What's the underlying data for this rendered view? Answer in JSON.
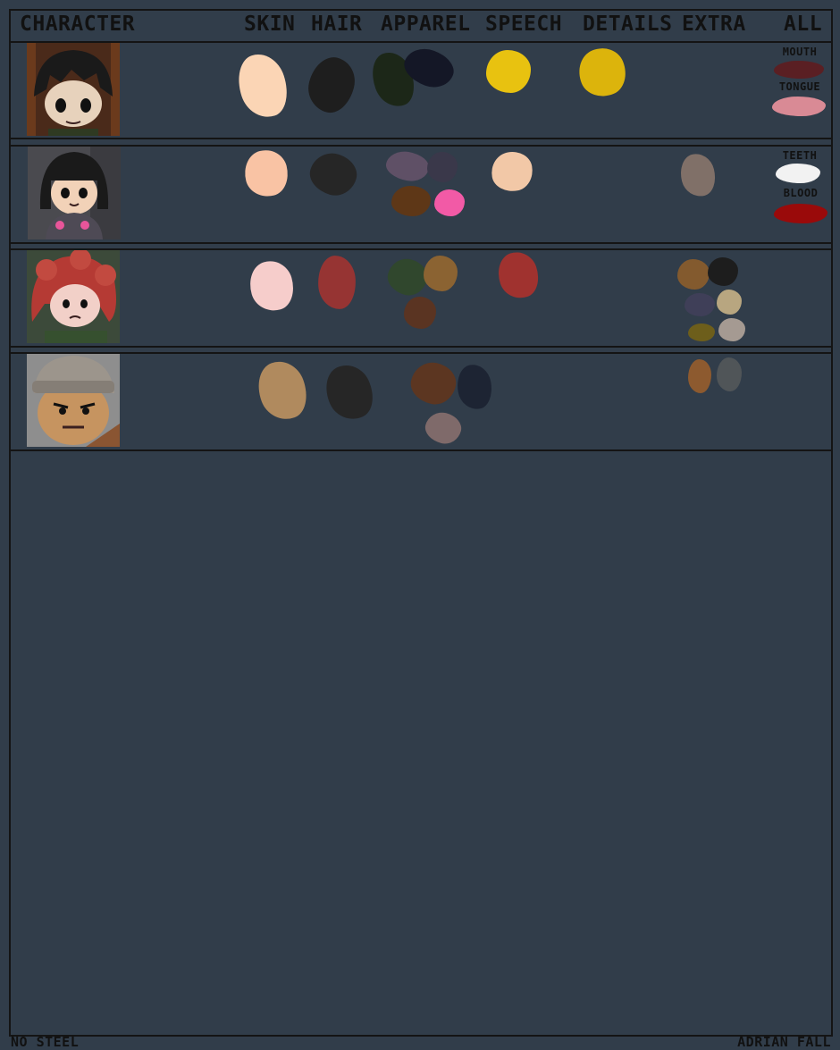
{
  "headers": {
    "character": "CHARACTER",
    "skin": "SKIN",
    "hair": "HAIR",
    "apparel": "APPAREL",
    "speech": "SPEECH",
    "details": "DETAILS",
    "extra": "EXTRA",
    "all": "ALL"
  },
  "rows": [
    {
      "portrait_icon": "dark-haired-girl-portrait",
      "skin": [
        "#fbd5b5"
      ],
      "hair": [
        "#1e1e1e"
      ],
      "apparel": [
        "#1c2718",
        "#141726"
      ],
      "speech": [
        "#e8c210"
      ],
      "details": [
        "#dcb40c"
      ],
      "extra": [],
      "all_labels": {
        "mouth": "MOUTH",
        "tongue": "TONGUE"
      },
      "all_colors": {
        "mouth": "#5a1f23",
        "tongue": "#d98a95"
      }
    },
    {
      "portrait_icon": "bob-haired-girl-portrait",
      "skin": [
        "#f9c3a4"
      ],
      "hair": [
        "#262626"
      ],
      "apparel": [
        "#5f5066",
        "#3a384a",
        "#5e3717",
        "#f25aa6"
      ],
      "speech": [
        "#f2c8a7"
      ],
      "details": [],
      "extra": [
        "#807068"
      ],
      "all_labels": {
        "teeth": "TEETH",
        "blood": "BLOOD"
      },
      "all_colors": {
        "teeth": "#f2f2f2",
        "blood": "#9a0a0a"
      }
    },
    {
      "portrait_icon": "red-haired-girl-portrait",
      "skin": [
        "#f6cdcb"
      ],
      "hair": [
        "#963433"
      ],
      "apparel": [
        "#30472d",
        "#8b6332",
        "#5a3422"
      ],
      "speech": [
        "#a0322f"
      ],
      "details": [],
      "extra": [
        "#835a2e",
        "#1d1d1d",
        "#3f3f58",
        "#b8a680",
        "#6d5e1b",
        "#a59a92"
      ]
    },
    {
      "portrait_icon": "beanie-man-portrait",
      "skin": [
        "#b08a5e"
      ],
      "hair": [
        "#262626"
      ],
      "apparel": [
        "#5c3621",
        "#1d2433",
        "#7f6a6a"
      ],
      "speech": [],
      "details": [],
      "extra": [
        "#8d5a2f",
        "#505558"
      ]
    }
  ],
  "footer": {
    "left": "NO STEEL",
    "right": "ADRIAN FALL"
  }
}
